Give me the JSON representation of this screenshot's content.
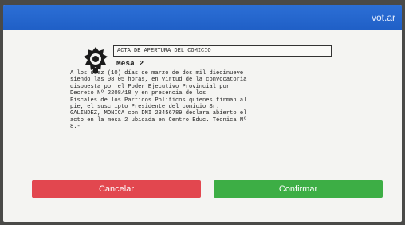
{
  "header": {
    "brand": "vot.ar"
  },
  "document": {
    "title": "ACTA DE APERTURA DEL COMICIO",
    "mesa": "Mesa 2",
    "body": "A los diez (10) días de marzo de dos mil diecinueve\nsiendo las 08:05 horas, en virtud de la convocatoria\ndispuesta por el Poder Ejecutivo Provincial por\nDecreto Nº 2208/18 y en presencia de los\nFiscales de los Partidos Políticos quienes firman al\npie, el suscripto Presidente del comicio Sr.\nGALINDEZ, MONICA con DNI 23456789 declara abierto el\nacto en la mesa 2 ubicada en Centro Educ. Técnica Nº\n8.-",
    "seal_icon": "provincial-seal-icon"
  },
  "actions": {
    "cancel_label": "Cancelar",
    "confirm_label": "Confirmar"
  },
  "colors": {
    "topbar": "#1f5fc6",
    "cancel": "#e2474f",
    "confirm": "#3dae45"
  }
}
